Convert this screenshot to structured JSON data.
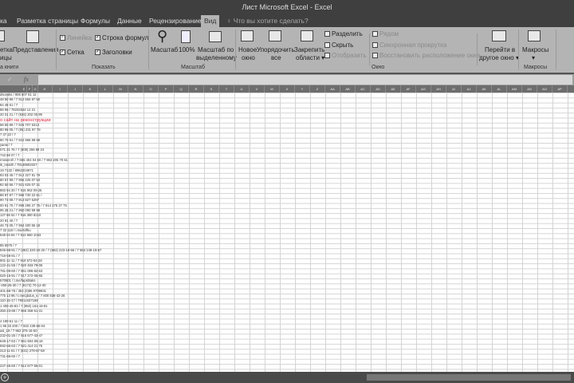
{
  "title": "Лист Microsoft Excel - Excel",
  "tabs": [
    "ка",
    "Разметка страницы",
    "Формулы",
    "Данные",
    "Рецензирование",
    "Вид"
  ],
  "active_tab": "Вид",
  "tell_me": "Что вы хотите сделать?",
  "ribbon": {
    "views": {
      "label1": "етка",
      "label1b": "ицы",
      "presentations": "Представления",
      "group": "а книги"
    },
    "show": {
      "ruler": "Линейка",
      "formula_bar": "Строка формул",
      "grid": "Сетка",
      "headings": "Заголовки",
      "group": "Показать"
    },
    "zoom": {
      "zoom": "Масштаб",
      "hundred": "100%",
      "zoom_sel1": "Масштаб по",
      "zoom_sel2": "выделенному",
      "group": "Масштаб"
    },
    "window": {
      "new1": "Новое",
      "new2": "окно",
      "arrange1": "Упорядочить",
      "arrange2": "все",
      "freeze1": "Закрепить",
      "freeze2": "области",
      "split": "Разделить",
      "hide": "Скрыть",
      "unhide": "Отобразить",
      "side": "Рядом",
      "sync": "Синхронная прокрутка",
      "reset": "Восстановить расположение окна",
      "switch1": "Перейти в",
      "switch2": "другое окно",
      "group": "Окно"
    },
    "macros": {
      "label": "Макросы",
      "group": "Макросы"
    }
  },
  "formula_bar": {
    "fx": "fx",
    "check": "✓",
    "value": ""
  },
  "columns": [
    "E",
    "F",
    "G",
    "H",
    "I",
    "J",
    "K",
    "L",
    "M",
    "N",
    "O",
    "P",
    "Q",
    "R",
    "S",
    "T",
    "U",
    "V",
    "W",
    "X",
    "Y",
    "Z",
    "AA",
    "AB",
    "AC",
    "AD",
    "AE",
    "AF",
    "AG",
    "AH",
    "AI",
    "AJ",
    "AK",
    "AL",
    "AM",
    "AN",
    "AO",
    "AP"
  ],
  "cells": [
    "dsonsks / 906 807 81 12",
    "48 80 99 / 7 912 655 97 50",
    "84 48 61 / 7",
    "88 99 / 78202844 12 21",
    "20 31 21 / 7 (926) 202 05 99",
    "о сайт на реконструкции",
    "68 50 89 / 7 925 707 5313",
    "80 99 05 / 7 (95) 231 97 79",
    "7 37 22 / 7",
    "80 70 91 / 7 922 966 99 98",
    "уаем / 7",
    "071 31 76 / 7 (909) 256 89 24",
    "743 68 07 / 7",
    "rmssenrh / 7 865 404 04 60 / 7 963 205 70 61",
    "ik_nissirh / 79139602027",
    "19 7132 / 8962204971",
    "93 03 45 / 7 912 327 81 79",
    "80 57 99 / 7 965 225 07 53",
    "82 50 56 / 7 921 625 07 31",
    "883 94 20 / 7 915 902 09 25",
    "88 87 87 / 7 968 730 22 81 /",
    "90 73 08 / 7 913 827 5297",
    "00 91 75 / 7 999 285 27 75 / 7 914 276 27 75",
    "95 28 21 / 7 950 090 99 98",
    "127 66 52 / 7 916 380 8210",
    "20 91 40 / 7",
    "46 73 05 / 7 964 400 55 18",
    "7 32 118 / i.mu/sirfku",
    "548 04 84 / 7 912 660 1033",
    "",
    "85 5076 / 7",
    "846-68-81 / 7 (863) 320-20-20 / 7 (863) 223-18-56 / 7 863 249-19-67",
    "716-58-81 / 7",
    "901-11-11 / 7 918 572-64-28",
    "122-41-55 / 7 920 483-79-06",
    "781-09-60 / 7 961 086-82-63",
    "020-15-91 / 7 917 272-05-55",
    "570801 / t.me/fapsblaks",
    "-250-26-30 / 7 (8172) 70-12-40",
    "401-68-78 / 353 (0)86 8709831",
    "775 13 96 / t.me/gbdus_s / 7 800 838-42-26",
    "110-15-17 / 79011637168",
    "1 400-45-83 / 7 (950) 161-18-81",
    "350-23-88 / 7 968 358-51-31",
    "",
    "4 190-51 11 / 7",
    "1 85 33 200 / 7 932 239-55-04",
    "asi_19 / 7 962 375-16-50",
    "232-01-25 / 7 916 677-43-47",
    "648-17-63 / 7 961-504-06-18",
    "592-66-63 / 7 921-414 21 75",
    "313-11-61 / 7 (831) 278-67-58",
    "731-66-60 / 7",
    "",
    "247-46-60 / 7 912 677-55-01"
  ],
  "red_row": 5
}
